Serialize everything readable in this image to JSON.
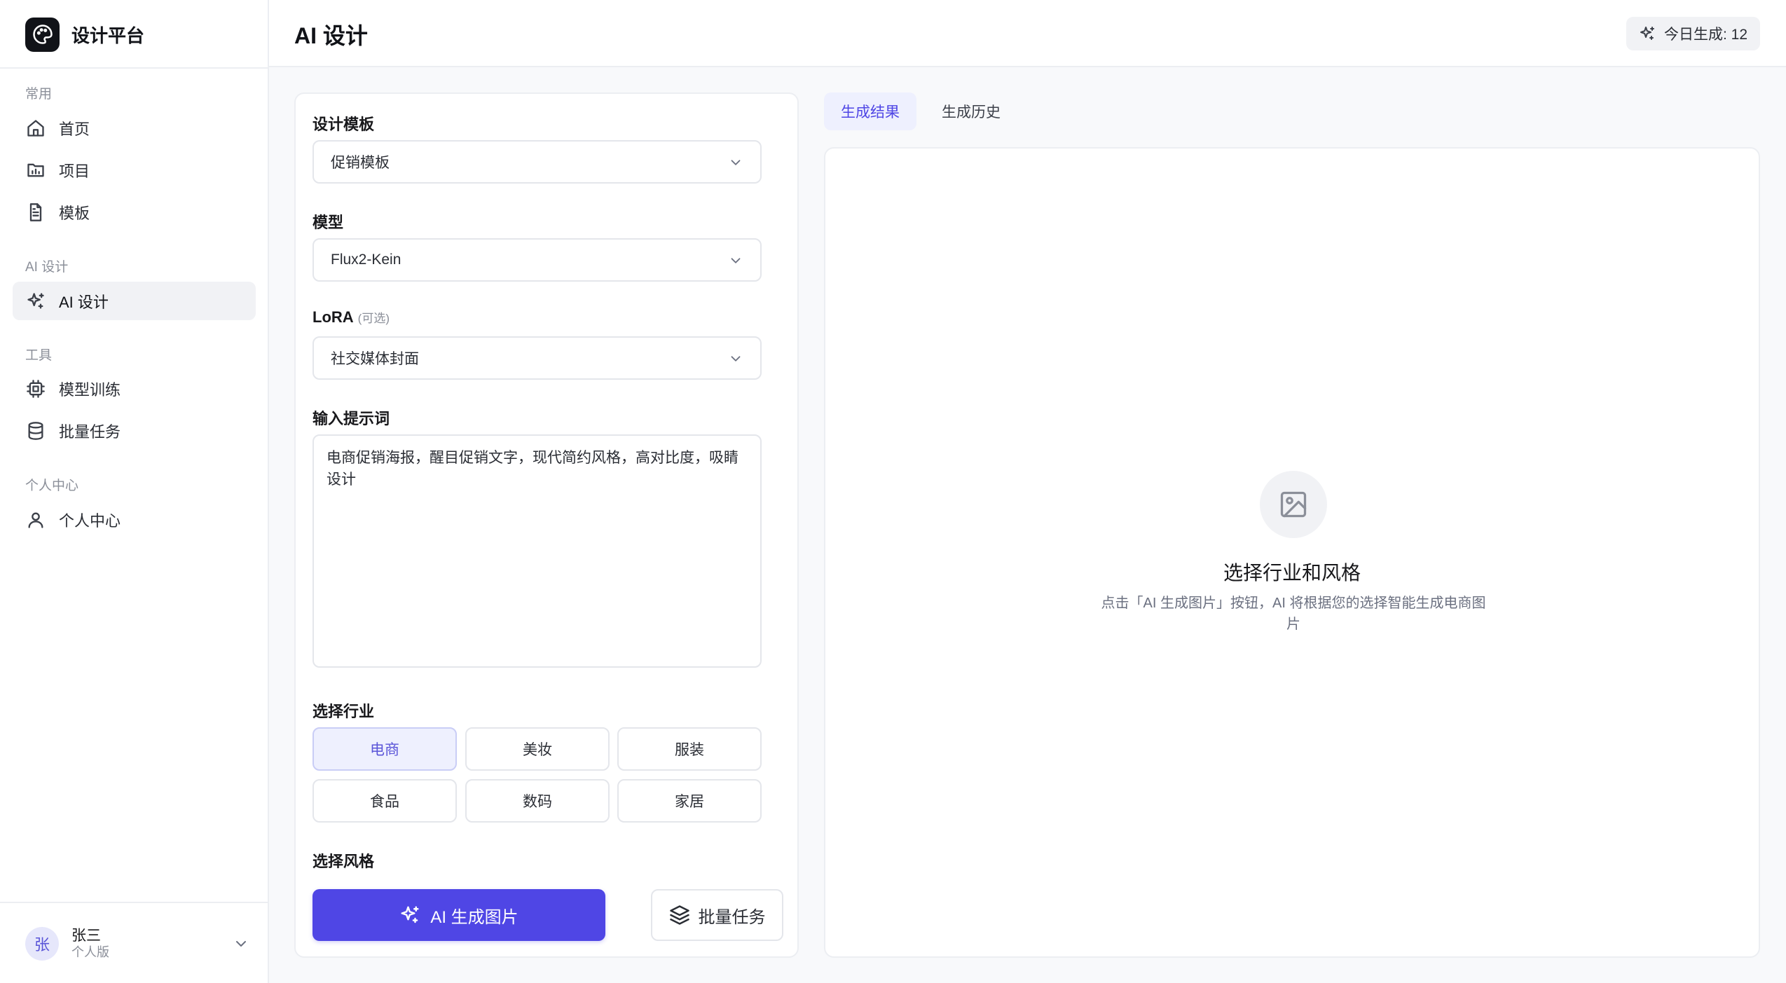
{
  "sidebar": {
    "brand": {
      "name": "设计平台",
      "icon": "palette-icon"
    },
    "sections": [
      {
        "title": "常用",
        "items": [
          {
            "label": "首页",
            "icon": "home-icon"
          },
          {
            "label": "项目",
            "icon": "folder-chart-icon"
          },
          {
            "label": "模板",
            "icon": "file-text-icon"
          }
        ]
      },
      {
        "title": "AI 设计",
        "items": [
          {
            "label": "AI 设计",
            "icon": "sparkles-icon",
            "active": true
          }
        ]
      },
      {
        "title": "工具",
        "items": [
          {
            "label": "模型训练",
            "icon": "cpu-icon"
          },
          {
            "label": "批量任务",
            "icon": "database-icon"
          }
        ]
      },
      {
        "title": "个人中心",
        "items": [
          {
            "label": "个人中心",
            "icon": "user-icon"
          }
        ]
      }
    ],
    "user": {
      "avatar_text": "张",
      "name": "张三",
      "plan": "个人版"
    }
  },
  "header": {
    "title": "AI 设计",
    "today_badge": "今日生成: 12"
  },
  "form": {
    "template": {
      "label": "设计模板",
      "value": "促销模板"
    },
    "model": {
      "label": "模型",
      "value": "Flux2-Kein"
    },
    "lora": {
      "label": "LoRA",
      "optional": "(可选)",
      "value": "社交媒体封面"
    },
    "prompt": {
      "label": "输入提示词",
      "value": "电商促销海报，醒目促销文字，现代简约风格，高对比度，吸睛设计"
    },
    "industry": {
      "label": "选择行业",
      "options": [
        "电商",
        "美妆",
        "服装",
        "食品",
        "数码",
        "家居"
      ],
      "selected": "电商"
    },
    "style": {
      "label": "选择风格"
    },
    "generate_button": "AI 生成图片",
    "batch_button": "批量任务"
  },
  "result": {
    "tabs": [
      "生成结果",
      "生成历史"
    ],
    "active_tab": "生成结果",
    "empty_icon": "image-icon",
    "empty_title": "选择行业和风格",
    "empty_desc": "点击「AI 生成图片」按钮，AI 将根据您的选择智能生成电商图片"
  },
  "colors": {
    "accent": "#4f46e5",
    "accent_soft": "#eef0fe",
    "sidebar_active": "#f1f2f5"
  }
}
